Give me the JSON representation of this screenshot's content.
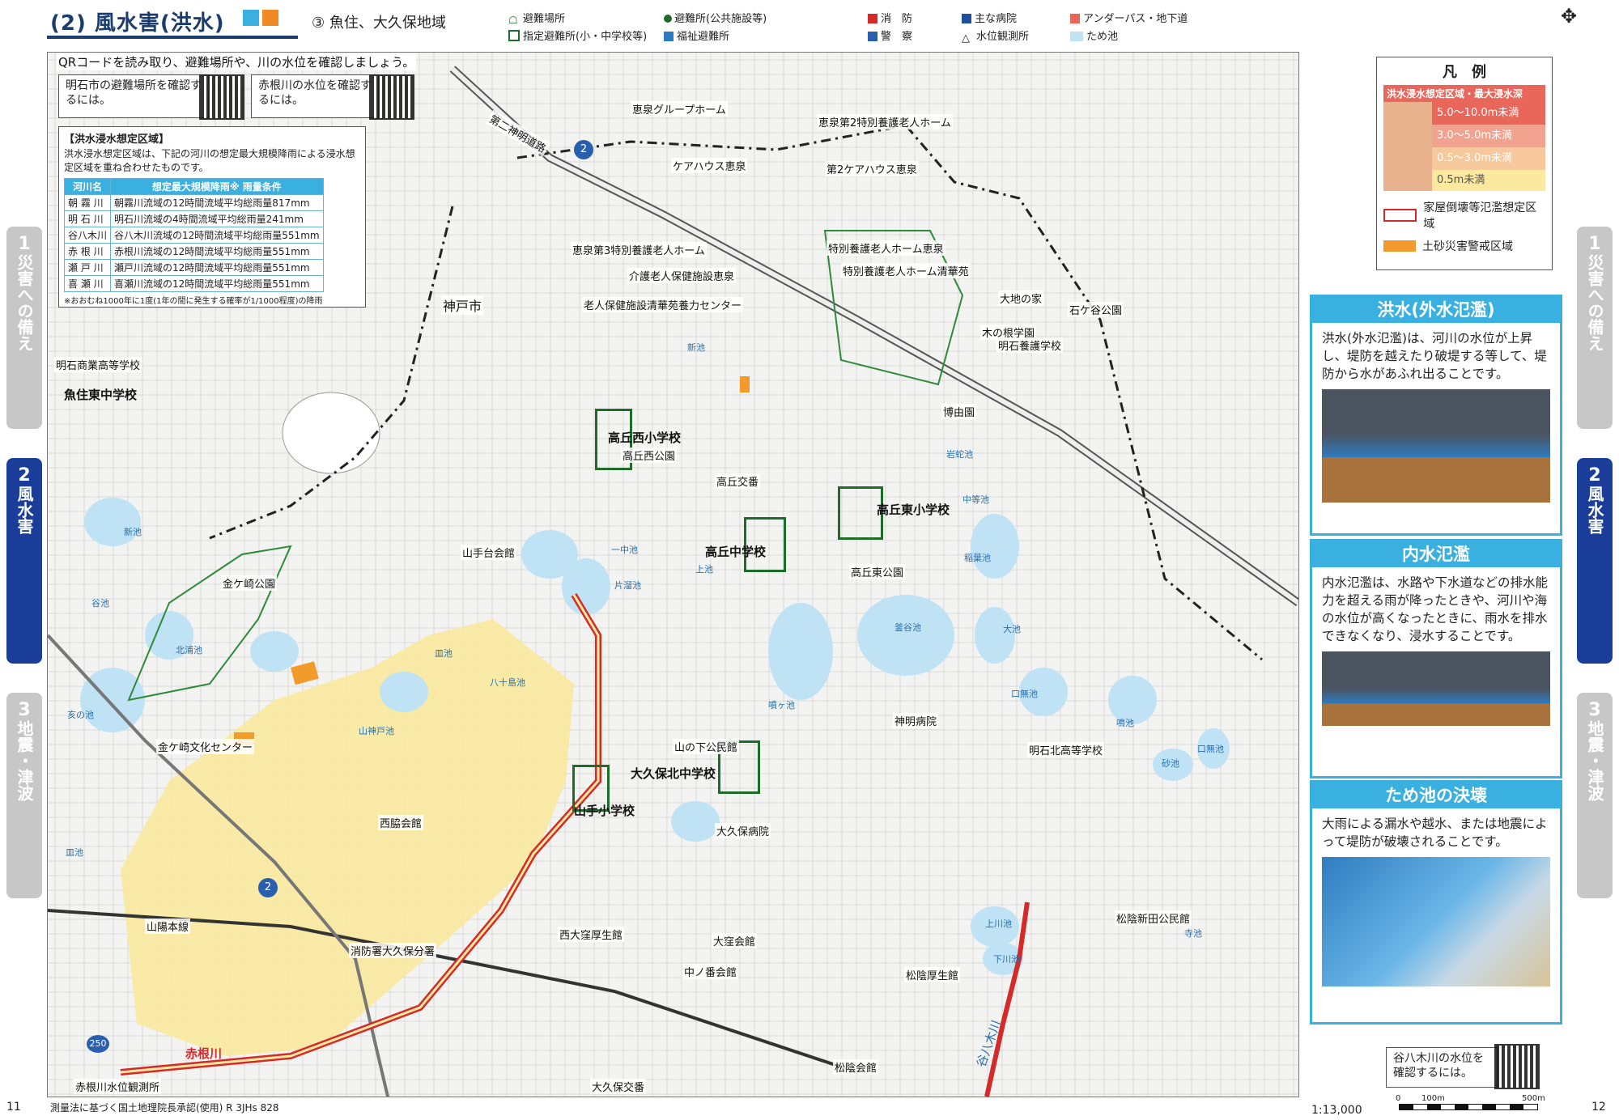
{
  "header": {
    "title": "(2) 風水害(洪水)",
    "subtitle": "③ 魚住、大久保地域"
  },
  "symbol_legend": [
    {
      "icon": "evacuation-site-icon",
      "label": "避難場所"
    },
    {
      "icon": "designated-shelter-icon",
      "label": "指定避難所(小・中学校等)"
    },
    {
      "icon": "shelter-public-icon",
      "label": "避難所(公共施設等)"
    },
    {
      "icon": "welfare-shelter-icon",
      "label": "福祉避難所"
    },
    {
      "icon": "fire-station-icon",
      "label": "消　防"
    },
    {
      "icon": "police-icon",
      "label": "警　察"
    },
    {
      "icon": "hospital-icon",
      "label": "主な病院"
    },
    {
      "icon": "water-gauge-icon",
      "label": "水位観測所"
    },
    {
      "icon": "underpass-icon",
      "label": "アンダーパス・地下道"
    },
    {
      "icon": "pond-icon",
      "label": "ため池"
    }
  ],
  "qr_notice": {
    "headline": "QRコードを読み取り、避難場所や、川の水位を確認しましょう。",
    "left_text": "明石市の避難場所を確認するには。",
    "right_text": "赤根川の水位を確認するには。",
    "bottom_text": "谷八木川の水位を確認するには。"
  },
  "flood_info": {
    "heading": "【洪水浸水想定区域】",
    "description": "洪水浸水想定区域は、下記の河川の想定最大規模降雨による浸水想定区域を重ね合わせたものです。",
    "col_river": "河川名",
    "col_rain": "想定最大規模降雨※ 雨量条件",
    "rows": [
      {
        "river": "朝 霧 川",
        "cond": "朝霧川流域の12時間流域平均総雨量817mm"
      },
      {
        "river": "明 石 川",
        "cond": "明石川流域の4時間流域平均総雨量241mm"
      },
      {
        "river": "谷八木川",
        "cond": "谷八木川流域の12時間流域平均総雨量551mm"
      },
      {
        "river": "赤 根 川",
        "cond": "赤根川流域の12時間流域平均総雨量551mm"
      },
      {
        "river": "瀬 戸 川",
        "cond": "瀬戸川流域の12時間流域平均総雨量551mm"
      },
      {
        "river": "喜 瀬 川",
        "cond": "喜瀬川流域の12時間流域平均総雨量551mm"
      }
    ],
    "footnote": "※おおむね1000年に1度(1年の間に発生する確率が1/1000程度)の降雨"
  },
  "legend": {
    "title": "凡　例",
    "depth_title": "洪水浸水想定区域・最大浸水深",
    "depths": [
      {
        "label": "5.0〜10.0m未満",
        "color": "#e8665a"
      },
      {
        "label": "3.0〜5.0m未満",
        "color": "#f2a38f"
      },
      {
        "label": "0.5〜3.0m未満",
        "color": "#f7c89b"
      },
      {
        "label": "0.5m未満",
        "color": "#fbe99f"
      }
    ],
    "collapse_label": "家屋倒壊等氾濫想定区域",
    "landslide_label": "土砂災害警戒区域",
    "landslide_color": "#f39a2c"
  },
  "info_boxes": [
    {
      "title": "洪水(外水氾濫)",
      "body": "洪水(外水氾濫)は、河川の水位が上昇し、堤防を越えたり破堤する等して、堤防から水があふれ出ることです。"
    },
    {
      "title": "内水氾濫",
      "body": "内水氾濫は、水路や下水道などの排水能力を超える雨が降ったときや、河川や海の水位が高くなったときに、雨水を排水できなくなり、浸水することです。"
    },
    {
      "title": "ため池の決壊",
      "body": "大雨による漏水や越水、または地震によって堤防が破壊されることです。"
    }
  ],
  "tabs": [
    {
      "num": "1",
      "label": "災害への備え",
      "active": false
    },
    {
      "num": "2",
      "label": "風水害",
      "active": true
    },
    {
      "num": "3",
      "label": "地震・津波",
      "active": false
    }
  ],
  "map_labels": {
    "facilities": [
      "恵泉グループホーム",
      "恵泉第2特別養護老人ホーム",
      "ケアハウス恵泉",
      "第2ケアハウス恵泉",
      "恵泉第3特別養護老人ホーム",
      "特別養護老人ホーム恵泉",
      "介護老人保健施設恵泉",
      "特別養護老人ホーム清華苑",
      "老人保健施設清華苑養力センター",
      "大地の家",
      "木の根学園",
      "明石養護学校",
      "石ケ谷公園",
      "博由園",
      "高丘交番",
      "山手台会館",
      "金ケ崎公園",
      "高丘西公園",
      "高丘東公園",
      "神明病院",
      "明石北高等学校",
      "山の下公民館",
      "大久保病院",
      "金ケ崎文化センター",
      "西脇会館",
      "消防署大久保分署",
      "西大窪厚生館",
      "大窪会館",
      "中ノ番会館",
      "松陰厚生館",
      "松陰会館",
      "松陰新田公民館",
      "赤根川水位観測所",
      "大久保交番",
      "明石商業高等学校",
      "神戸市",
      "第二神明道路",
      "山陽本線"
    ],
    "schools": [
      "高丘西小学校",
      "高丘中学校",
      "高丘東小学校",
      "大久保北中学校",
      "山手小学校",
      "魚住東中学校"
    ],
    "ponds": [
      "新池",
      "岩蛇池",
      "中等池",
      "稲葉池",
      "新池",
      "谷池",
      "北浦池",
      "皿池",
      "八十島池",
      "亥の池",
      "山神戸池",
      "一中池",
      "片溜池",
      "上池",
      "噴ヶ池",
      "釜谷池",
      "大池",
      "口無池",
      "鳴池",
      "砂池",
      "口無池",
      "上川池",
      "下川池",
      "寺池",
      "皿池"
    ],
    "rivers": [
      "赤根川",
      "谷八木川"
    ],
    "route_shield": "2",
    "route_shield_2": "250"
  },
  "footer": {
    "page_left": "11",
    "page_right": "12",
    "credit": "測量法に基づく国土地理院長承認(使用) R 3JHs 828",
    "scale": "1:13,000",
    "scale_0": "0",
    "scale_100": "100m",
    "scale_500": "500m"
  }
}
